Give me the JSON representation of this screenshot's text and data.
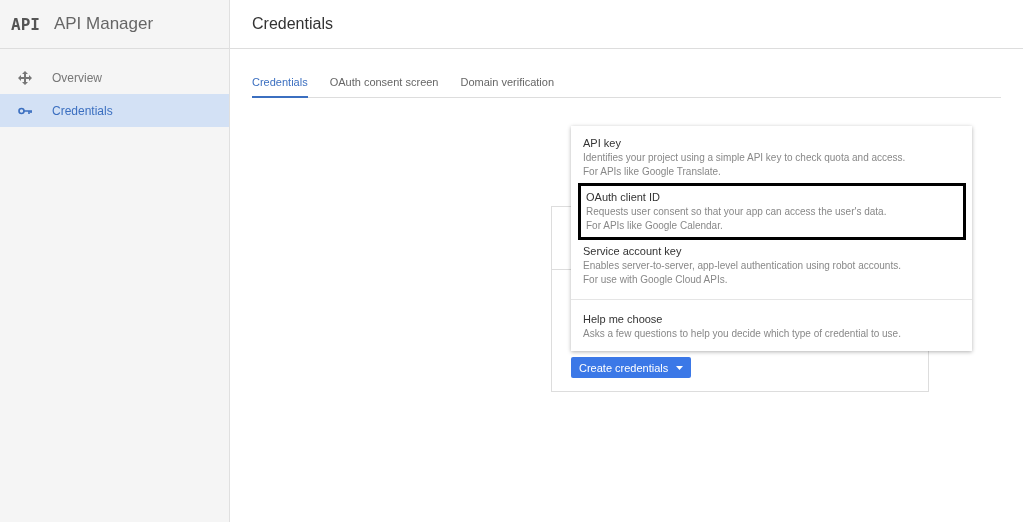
{
  "app": {
    "logo": "API",
    "title": "API Manager"
  },
  "sidebar": {
    "items": [
      {
        "label": "Overview",
        "kind": "overview",
        "selected": false
      },
      {
        "label": "Credentials",
        "kind": "credentials",
        "selected": true
      }
    ]
  },
  "page": {
    "title": "Credentials"
  },
  "tabs": [
    {
      "label": "Credentials",
      "selected": true
    },
    {
      "label": "OAuth consent screen",
      "selected": false
    },
    {
      "label": "Domain verification",
      "selected": false
    }
  ],
  "create_button": {
    "label": "Create credentials"
  },
  "menu": {
    "items": [
      {
        "title": "API key",
        "lines": [
          "Identifies your project using a simple API key to check quota and access.",
          "For APIs like Google Translate."
        ],
        "highlighted": false,
        "divider_before": false
      },
      {
        "title": "OAuth client ID",
        "lines": [
          "Requests user consent so that your app can access the user's data.",
          "For APIs like Google Calendar."
        ],
        "highlighted": true,
        "divider_before": false
      },
      {
        "title": "Service account key",
        "lines": [
          "Enables server-to-server, app-level authentication using robot accounts.",
          "For use with Google Cloud APIs."
        ],
        "highlighted": false,
        "divider_before": false
      },
      {
        "title": "Help me choose",
        "lines": [
          "Asks a few questions to help you decide which type of credential to use."
        ],
        "highlighted": false,
        "divider_before": true
      }
    ]
  }
}
